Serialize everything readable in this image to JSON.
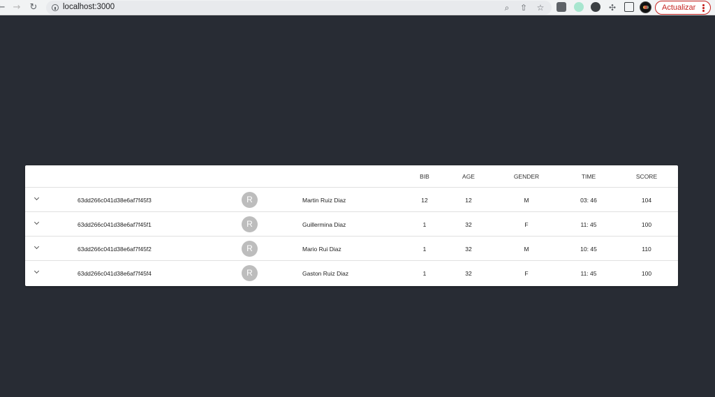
{
  "browser": {
    "url": "localhost:3000",
    "update_label": "Actualizar"
  },
  "table": {
    "headers": {
      "bib": "BIB",
      "age": "AGE",
      "gender": "GENDER",
      "time": "TIME",
      "score": "SCORE"
    },
    "rows": [
      {
        "id": "63dd266c041d38e6af7f45f3",
        "avatar": "R",
        "name": "Martin Ruiz Diaz",
        "bib": "12",
        "age": "12",
        "gender": "M",
        "time": "03: 46",
        "score": "104"
      },
      {
        "id": "63dd266c041d38e6af7f45f1",
        "avatar": "R",
        "name": "Guillermina Diaz",
        "bib": "1",
        "age": "32",
        "gender": "F",
        "time": "11: 45",
        "score": "100"
      },
      {
        "id": "63dd266c041d38e6af7f45f2",
        "avatar": "R",
        "name": "Mario Rui Diaz",
        "bib": "1",
        "age": "32",
        "gender": "M",
        "time": "10: 45",
        "score": "110"
      },
      {
        "id": "63dd266c041d38e6af7f45f4",
        "avatar": "R",
        "name": "Gaston Ruiz Diaz",
        "bib": "1",
        "age": "32",
        "gender": "F",
        "time": "11: 45",
        "score": "100"
      }
    ]
  }
}
